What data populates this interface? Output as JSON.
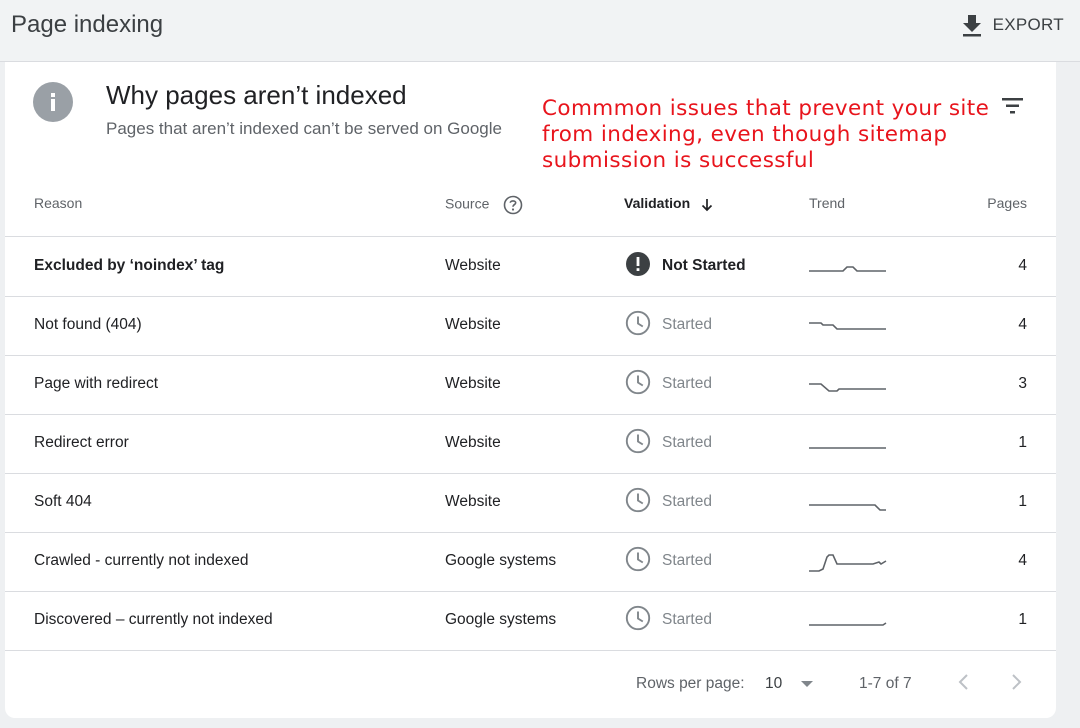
{
  "header": {
    "title": "Page indexing",
    "export_label": "EXPORT"
  },
  "card": {
    "title": "Why pages aren’t indexed",
    "subtitle": "Pages that aren’t indexed can’t be served on Google",
    "annotation": "Commmon issues that prevent your site from indexing, even though sitemap submission is successful"
  },
  "table": {
    "columns": {
      "reason": "Reason",
      "source": "Source",
      "validation": "Validation",
      "trend": "Trend",
      "pages": "Pages"
    },
    "rows": [
      {
        "reason": "Excluded by ‘noindex’ tag",
        "source": "Website",
        "validation": "Not Started",
        "status_icon": "alert-icon",
        "pages": "4"
      },
      {
        "reason": "Not found (404)",
        "source": "Website",
        "validation": "Started",
        "status_icon": "clock-icon",
        "pages": "4"
      },
      {
        "reason": "Page with redirect",
        "source": "Website",
        "validation": "Started",
        "status_icon": "clock-icon",
        "pages": "3"
      },
      {
        "reason": "Redirect error",
        "source": "Website",
        "validation": "Started",
        "status_icon": "clock-icon",
        "pages": "1"
      },
      {
        "reason": "Soft 404",
        "source": "Website",
        "validation": "Started",
        "status_icon": "clock-icon",
        "pages": "1"
      },
      {
        "reason": "Crawled - currently not indexed",
        "source": "Google systems",
        "validation": "Started",
        "status_icon": "clock-icon",
        "pages": "4"
      },
      {
        "reason": "Discovered – currently not indexed",
        "source": "Google systems",
        "validation": "Started",
        "status_icon": "clock-icon",
        "pages": "1"
      }
    ]
  },
  "footer": {
    "rows_per_page_label": "Rows per page:",
    "rows_per_page_value": "10",
    "range": "1-7 of 7"
  },
  "colors": {
    "annotation": "#e8141c",
    "trend_line": "#5f6368",
    "alert_icon": "#3c4043"
  }
}
